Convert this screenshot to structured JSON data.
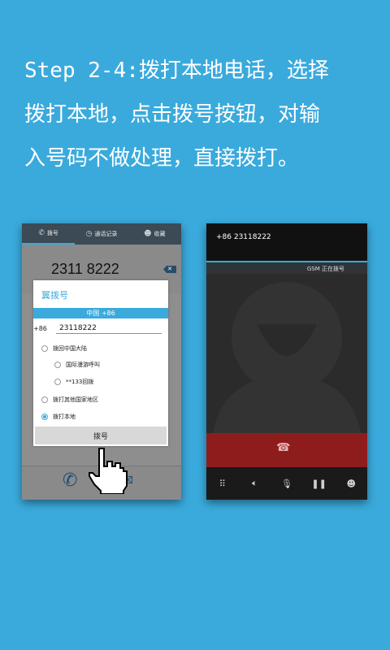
{
  "caption": {
    "line1": "Step 2-4:拨打本地电话，选择",
    "line2": "拨打本地，点击拨号按钮，对输",
    "line3": "入号码不做处理，直接拨打。"
  },
  "left_phone": {
    "tabs": [
      {
        "label": "拨号",
        "icon": "phone-icon"
      },
      {
        "label": "通话记录",
        "icon": "clock-icon"
      },
      {
        "label": "收藏",
        "icon": "contact-icon"
      }
    ],
    "dialed_number": "2311 8222",
    "dialog": {
      "title": "翼拨号",
      "country": "中国 +86",
      "prefix": "+86",
      "number_value": "23118222",
      "options": [
        {
          "label": "拨回中国大陆",
          "selected": false
        },
        {
          "label": "国际漫游呼叫",
          "selected": false
        },
        {
          "label": "**133回拨",
          "selected": false
        },
        {
          "label": "拨打其他国家地区",
          "selected": false
        },
        {
          "label": "拨打本地",
          "selected": true
        }
      ],
      "dial_button": "拨号"
    }
  },
  "right_phone": {
    "number": "+86 23118222",
    "status": "GSM  正在拨号",
    "controls": [
      "keypad-icon",
      "speaker-icon",
      "mute-icon",
      "hold-icon",
      "add-call-icon"
    ]
  },
  "colors": {
    "background": "#3aaadc",
    "accent": "#3aaadc",
    "end_call": "#8f1c1c"
  }
}
